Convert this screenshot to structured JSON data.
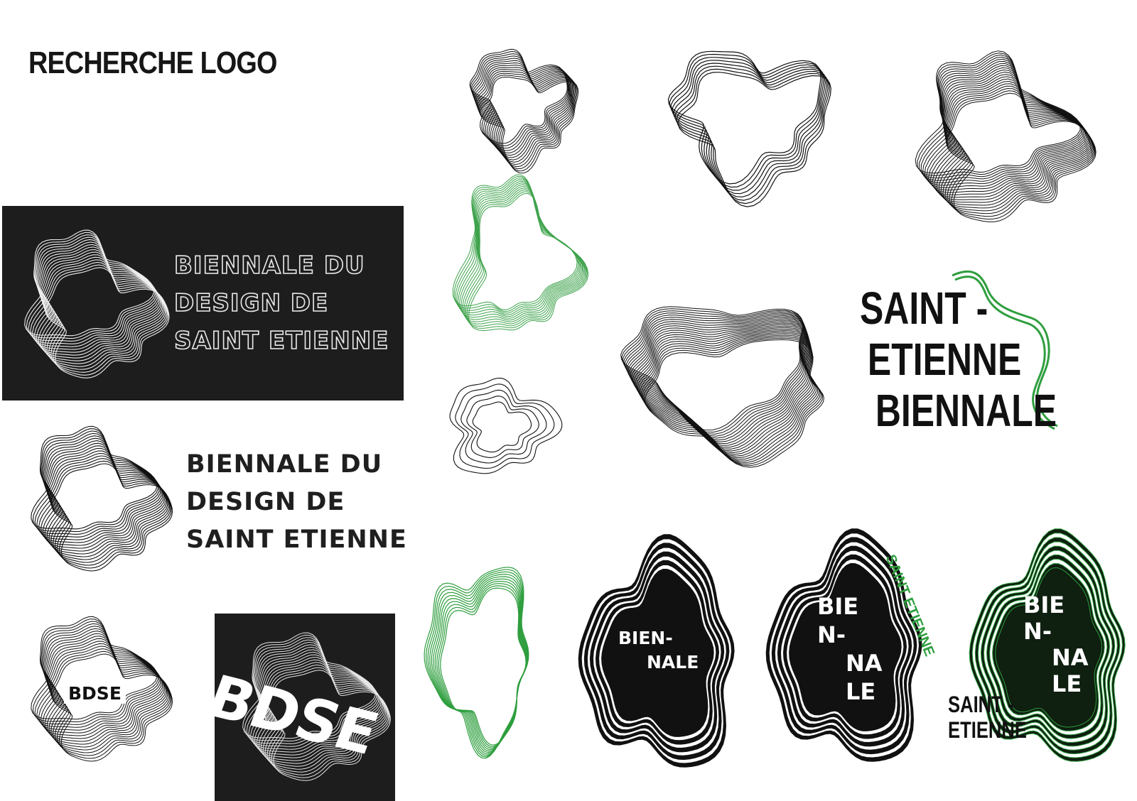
{
  "board": {
    "title": "RECHERCHE LOGO"
  },
  "logo_dark_banner": {
    "lines": [
      "BIENNALE DU",
      "DESIGN DE",
      "SAINT ETIENNE"
    ]
  },
  "logo_light_banner": {
    "lines": [
      "BIENNALE DU",
      "DESIGN DE",
      "SAINT ETIENNE"
    ]
  },
  "logo_bdse_small": {
    "text": "BDSE"
  },
  "logo_bdse_square": {
    "text": "BDSE"
  },
  "logo_saint_etienne_wordmark": {
    "lines": [
      "SAINT -",
      "ETIENNE",
      "BIENNALE"
    ]
  },
  "logo_black_blob_1": {
    "lines": [
      "BIEN-",
      "NALE"
    ]
  },
  "logo_black_blob_2": {
    "lines": [
      "BIE",
      "N-",
      "NA",
      "LE"
    ],
    "side_text": "SAINT ETIENNE"
  },
  "logo_green_blob": {
    "lines": [
      "BIE",
      "N-",
      "NA",
      "LE"
    ],
    "caption_lines": [
      "SAINT -",
      "ETIENNE"
    ]
  },
  "colors": {
    "ink": "#111111",
    "panel": "#1d1d1d",
    "green": "#2e9e3e",
    "light_green": "#5cb567",
    "paper": "#ffffff"
  }
}
